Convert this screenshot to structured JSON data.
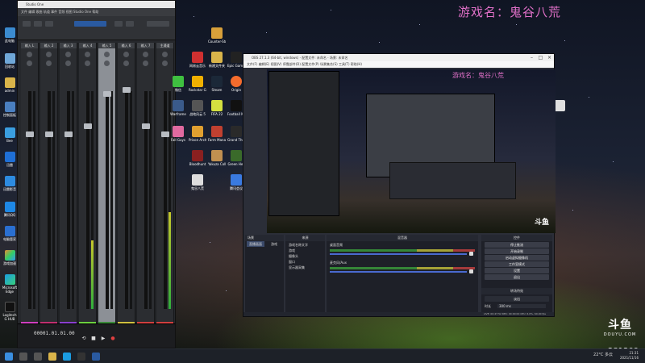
{
  "stream_overlay": {
    "title": "游戏名：鬼谷八荒"
  },
  "daw": {
    "window_title": "Studio One",
    "menu": "文件  编辑  歌曲  轨道  事件  音频  视图  Studio One  帮助",
    "channels": [
      {
        "name": "输入 L"
      },
      {
        "name": "输入 2"
      },
      {
        "name": "输入 3"
      },
      {
        "name": "输入 4"
      },
      {
        "name": "输入 5"
      },
      {
        "name": "输入 6"
      },
      {
        "name": "输入 7"
      },
      {
        "name": "主通道"
      }
    ],
    "timecode": "00001.01.01.00",
    "transport": {
      "loop": "⟲",
      "stop": "■",
      "play": "▶",
      "record": "●"
    }
  },
  "desktop_icons_left": [
    {
      "label": "此电脑"
    },
    {
      "label": "回收站"
    },
    {
      "label": "admin"
    },
    {
      "label": "控制面板"
    },
    {
      "label": "Bee"
    },
    {
      "label": "迅雷"
    },
    {
      "label": "迅雷影音"
    },
    {
      "label": "腾讯QQ"
    },
    {
      "label": "电脑管家"
    },
    {
      "label": "游戏加速"
    },
    {
      "label": "Microsoft Edge"
    },
    {
      "label": "Logitech G HUB"
    }
  ],
  "desktop_icons_grid": [
    {
      "label": "Counter-Strike Global Off..."
    },
    {
      "label": "网易云音乐"
    },
    {
      "label": "新建文件夹"
    },
    {
      "label": "Epic Games"
    },
    {
      "label": "Origin"
    },
    {
      "label": "微信"
    },
    {
      "label": "Rockstar Games"
    },
    {
      "label": "Steam"
    },
    {
      "label": "Origin"
    },
    {
      "label": "Warframe"
    },
    {
      "label": "Cult Open..."
    },
    {
      "label": "战地风云 5"
    },
    {
      "label": "FIFA 22"
    },
    {
      "label": "Football Manager..."
    },
    {
      "label": "Fall Guys"
    },
    {
      "label": "Prison Architect"
    },
    {
      "label": "Farm Manag..."
    },
    {
      "label": "Grand Theft Auto V"
    },
    {
      "label": "Bloodhunt"
    },
    {
      "label": "Yakuza Collection"
    },
    {
      "label": "Green Hell"
    },
    {
      "label": "鬼谷八荒"
    },
    {
      "label": "腾讯会议"
    }
  ],
  "obs": {
    "window_title": "OBS 27.1.3 (64-bit, windows) - 配置文件: 未命名 - 场景: 未命名",
    "menu": "文件(F)  编辑(E)  视图(V)  停靠部件(D)  配置文件(P)  场景集合(S)  工具(T)  帮助(H)",
    "preview_title": "游戏名：鬼谷八荒",
    "preview_logo": "斗鱼",
    "docks": {
      "scenes": "场景",
      "sources": "来源",
      "mixer": "混音器",
      "controls": "控件",
      "transitions": "转场特效"
    },
    "scene_tabs": [
      "直播画面",
      "游戏"
    ],
    "sources": [
      {
        "name": "游戏名称文字"
      },
      {
        "name": "游戏"
      },
      {
        "name": "摄像头"
      },
      {
        "name": "窗口"
      },
      {
        "name": "显示器采集"
      }
    ],
    "mixer_channels": [
      {
        "name": "桌面音频",
        "level": 0.72
      },
      {
        "name": "麦克风/Aux",
        "level": 0.55
      }
    ],
    "controls": [
      "停止推流",
      "开始录制",
      "启动虚拟摄像机",
      "工作室模式",
      "设置",
      "退出"
    ],
    "transition": {
      "name": "淡出",
      "duration_label": "时长",
      "duration": "300 ms"
    },
    "status": "LIVE: 00:47:52   REC: 00:00:00   CPU: 6.0%, 60.00 fps"
  },
  "taskbar": {
    "weather": "22°C 多云",
    "time": "21:31",
    "date": "2021/11/16"
  },
  "douyu": {
    "mark": "斗鱼",
    "sub": "DOUYU.COM"
  },
  "room_id": "281209"
}
